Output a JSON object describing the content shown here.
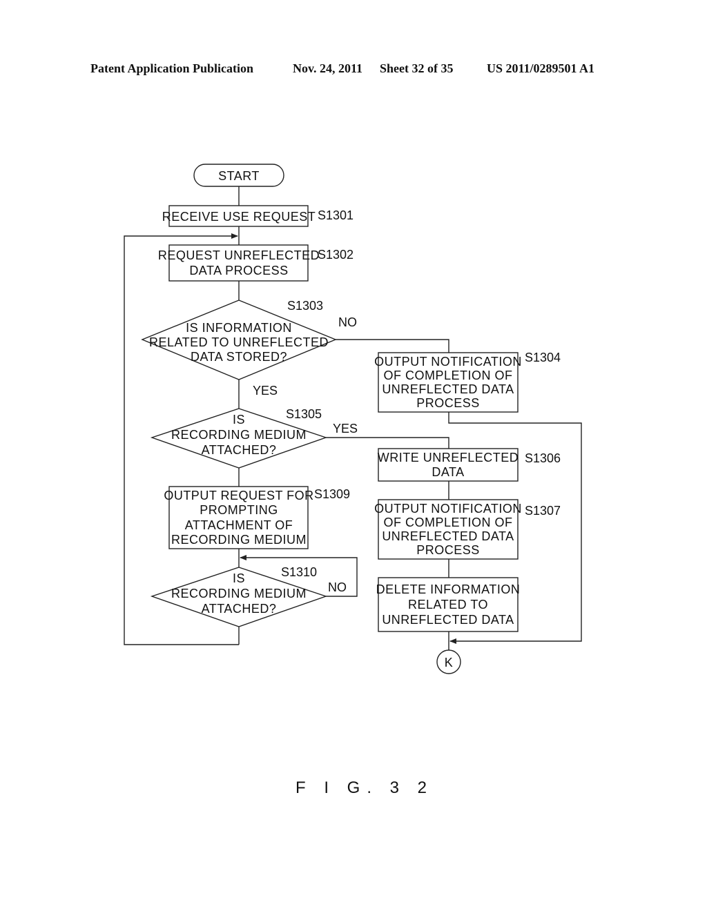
{
  "header": {
    "publication": "Patent Application Publication",
    "date": "Nov. 24, 2011",
    "sheet": "Sheet 32 of 35",
    "number": "US 2011/0289501 A1"
  },
  "flowchart": {
    "start": "START",
    "connector": "K",
    "steps": {
      "s1301": {
        "id": "S1301",
        "lines": [
          "RECEIVE USE REQUEST"
        ]
      },
      "s1302": {
        "id": "S1302",
        "lines": [
          "REQUEST UNREFLECTED",
          "DATA PROCESS"
        ]
      },
      "s1303": {
        "id": "S1303",
        "lines": [
          "IS INFORMATION",
          "RELATED TO UNREFLECTED",
          "DATA STORED?"
        ],
        "yes": "YES",
        "no": "NO"
      },
      "s1304": {
        "id": "S1304",
        "lines": [
          "OUTPUT NOTIFICATION",
          "OF COMPLETION OF",
          "UNREFLECTED DATA",
          "PROCESS"
        ]
      },
      "s1305": {
        "id": "S1305",
        "lines": [
          "IS",
          "RECORDING MEDIUM",
          "ATTACHED?"
        ],
        "yes": "YES"
      },
      "s1306": {
        "id": "S1306",
        "lines": [
          "WRITE UNREFLECTED",
          "DATA"
        ]
      },
      "s1307": {
        "id": "S1307",
        "lines": [
          "OUTPUT NOTIFICATION",
          "OF COMPLETION OF",
          "UNREFLECTED DATA",
          "PROCESS"
        ]
      },
      "s1308": {
        "lines": [
          "DELETE INFORMATION",
          "RELATED TO",
          "UNREFLECTED DATA"
        ]
      },
      "s1309": {
        "id": "S1309",
        "lines": [
          "OUTPUT REQUEST FOR",
          "PROMPTING",
          "ATTACHMENT OF",
          "RECORDING MEDIUM"
        ]
      },
      "s1310": {
        "id": "S1310",
        "lines": [
          "IS",
          "RECORDING MEDIUM",
          "ATTACHED?"
        ],
        "no": "NO"
      }
    }
  },
  "figure_caption": "F I G. 3 2"
}
